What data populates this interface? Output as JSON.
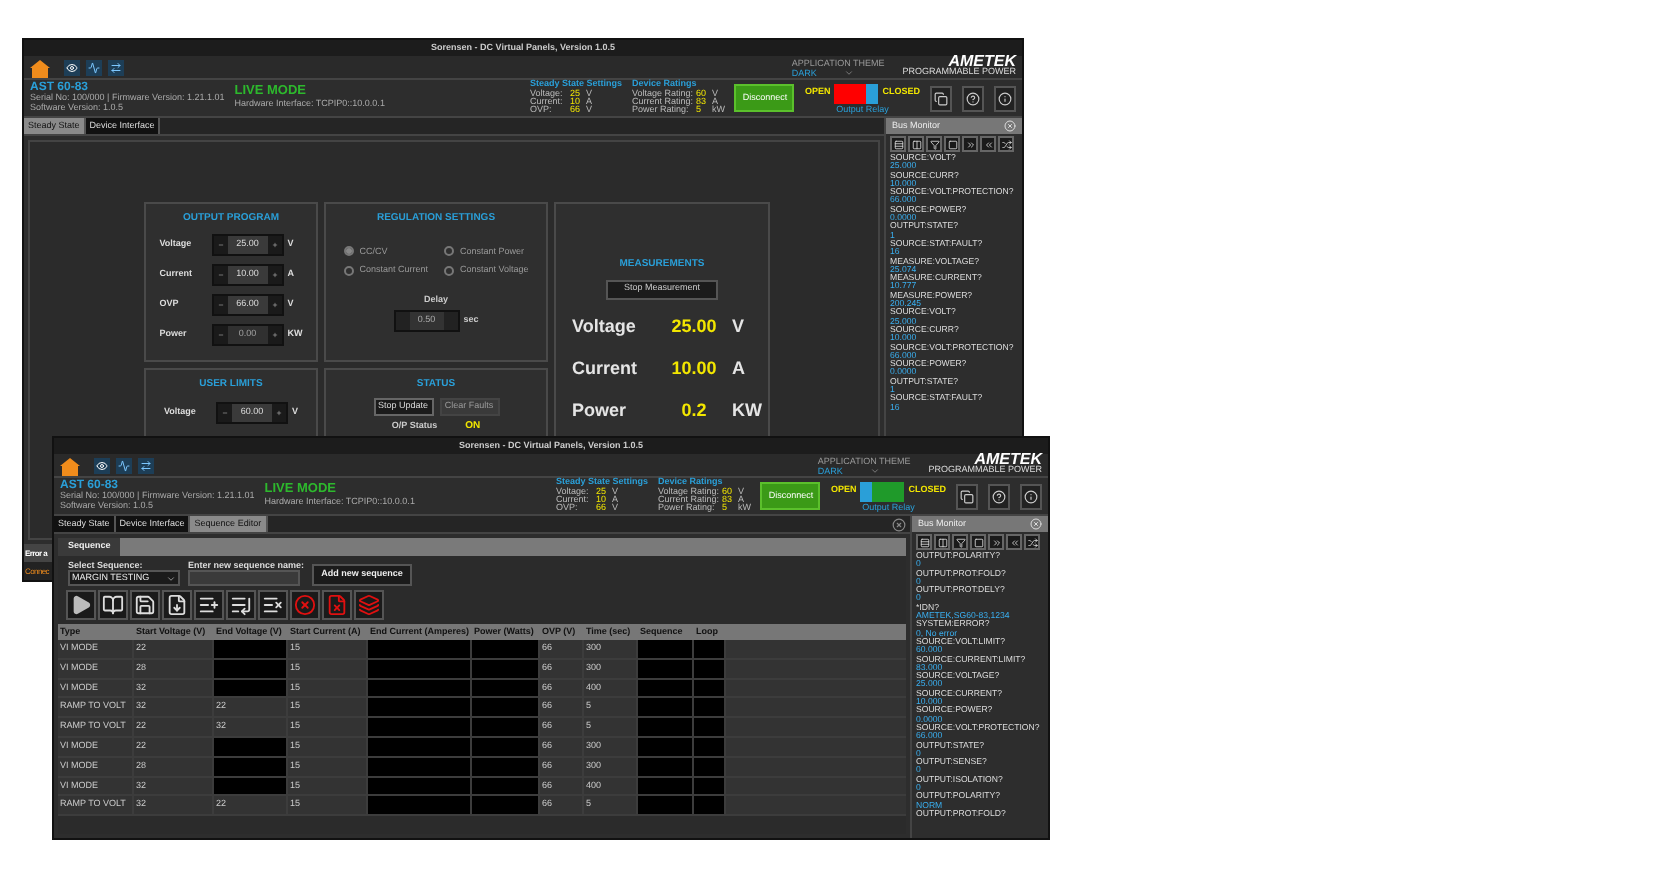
{
  "windows": [
    {
      "title": "Sorensen - DC Virtual Panels, Version 1.0.5",
      "theme_label": "APPLICATION THEME",
      "theme_value": "DARK",
      "logo": {
        "name": "AMETEK",
        "tagline": "PROGRAMMABLE POWER"
      },
      "device": {
        "model": "AST 60-83",
        "serial": "Serial No: 100/000 | Firmware Version: 1.21.1.01",
        "software": "Software Version: 1.0.5",
        "mode": "LIVE MODE",
        "interface": "Hardware Interface: TCPIP0::10.0.0.1"
      },
      "steady_state_settings": {
        "title": "Steady State Settings",
        "rows": [
          {
            "label": "Voltage:",
            "value": "25",
            "unit": "V"
          },
          {
            "label": "Current:",
            "value": "10",
            "unit": "A"
          },
          {
            "label": "OVP:",
            "value": "66",
            "unit": "V"
          }
        ]
      },
      "device_ratings": {
        "title": "Device Ratings",
        "rows": [
          {
            "label": "Voltage Rating:",
            "value": "60",
            "unit": "V"
          },
          {
            "label": "Current Rating:",
            "value": "83",
            "unit": "A"
          },
          {
            "label": "Power Rating:",
            "value": "5",
            "unit": "kW"
          }
        ]
      },
      "disconnect": "Disconnect",
      "relay": {
        "open": "OPEN",
        "closed": "CLOSED",
        "caption": "Output Relay",
        "is_closed": false
      },
      "tabs": [
        {
          "label": "Steady State",
          "selected": true
        },
        {
          "label": "Device Interface",
          "selected": false
        }
      ],
      "content": {
        "kind": "steady_state",
        "output_program": {
          "title": "OUTPUT PROGRAM",
          "rows": [
            {
              "label": "Voltage",
              "value": "25.00",
              "unit": "V",
              "disabled": false
            },
            {
              "label": "Current",
              "value": "10.00",
              "unit": "A",
              "disabled": false
            },
            {
              "label": "OVP",
              "value": "66.00",
              "unit": "V",
              "disabled": false
            },
            {
              "label": "Power",
              "value": "0.00",
              "unit": "KW",
              "disabled": true
            }
          ]
        },
        "regulation": {
          "title": "REGULATION SETTINGS",
          "options": [
            {
              "label": "CC/CV",
              "selected": true
            },
            {
              "label": "Constant Power",
              "selected": false
            },
            {
              "label": "Constant Current",
              "selected": false
            },
            {
              "label": "Constant Voltage",
              "selected": false
            }
          ],
          "delay": {
            "label": "Delay",
            "value": "0.50",
            "unit": "sec"
          }
        },
        "measurements": {
          "title": "MEASUREMENTS",
          "button": "Stop Measurement",
          "readings": [
            {
              "label": "Voltage",
              "value": "25.00",
              "unit": "V"
            },
            {
              "label": "Current",
              "value": "10.00",
              "unit": "A"
            },
            {
              "label": "Power",
              "value": "0.2",
              "unit": "KW"
            }
          ]
        },
        "user_limits": {
          "title": "USER LIMITS",
          "rows": [
            {
              "label": "Voltage",
              "value": "60.00",
              "unit": "V",
              "disabled": false
            }
          ]
        },
        "status": {
          "title": "STATUS",
          "buttons": [
            {
              "label": "Stop Update",
              "disabled": false
            },
            {
              "label": "Clear Faults",
              "disabled": true
            }
          ],
          "op_label": "O/P Status",
          "op_value": "ON"
        }
      },
      "bus_monitor": {
        "title": "Bus Monitor",
        "lines": [
          {
            "command": "SOURCE:VOLT?",
            "response": "25.000"
          },
          {
            "command": "SOURCE:CURR?",
            "response": "10.000"
          },
          {
            "command": "SOURCE:VOLT:PROTECTION?",
            "response": "66.000"
          },
          {
            "command": "SOURCE:POWER?",
            "response": "0.0000"
          },
          {
            "command": "OUTPUT:STATE?",
            "response": "1"
          },
          {
            "command": "SOURCE:STAT:FAULT?",
            "response": "16"
          },
          {
            "command": "MEASURE:VOLTAGE?",
            "response": "25.074"
          },
          {
            "command": "MEASURE:CURRENT?",
            "response": "10.777"
          },
          {
            "command": "MEASURE:POWER?",
            "response": "200.245"
          },
          {
            "command": "SOURCE:VOLT?",
            "response": "25.000"
          },
          {
            "command": "SOURCE:CURR?",
            "response": "10.000"
          },
          {
            "command": "SOURCE:VOLT:PROTECTION?",
            "response": "66.000"
          },
          {
            "command": "SOURCE:POWER?",
            "response": "0.0000"
          },
          {
            "command": "OUTPUT:STATE?",
            "response": "1"
          },
          {
            "command": "SOURCE:STAT:FAULT?",
            "response": "16"
          }
        ]
      },
      "status_bar": [
        {
          "text": "Error a",
          "kind": "error"
        },
        {
          "text": "Connec",
          "kind": "connection"
        }
      ]
    },
    {
      "title": "Sorensen - DC Virtual Panels, Version 1.0.5",
      "theme_label": "APPLICATION THEME",
      "theme_value": "DARK",
      "logo": {
        "name": "AMETEK",
        "tagline": "PROGRAMMABLE POWER"
      },
      "device": {
        "model": "AST 60-83",
        "serial": "Serial No: 100/000 | Firmware Version: 1.21.1.01",
        "software": "Software Version: 1.0.5",
        "mode": "LIVE MODE",
        "interface": "Hardware Interface: TCPIP0::10.0.0.1"
      },
      "steady_state_settings": {
        "title": "Steady State Settings",
        "rows": [
          {
            "label": "Voltage:",
            "value": "25",
            "unit": "V"
          },
          {
            "label": "Current:",
            "value": "10",
            "unit": "A"
          },
          {
            "label": "OVP:",
            "value": "66",
            "unit": "V"
          }
        ]
      },
      "device_ratings": {
        "title": "Device Ratings",
        "rows": [
          {
            "label": "Voltage Rating:",
            "value": "60",
            "unit": "V"
          },
          {
            "label": "Current Rating:",
            "value": "83",
            "unit": "A"
          },
          {
            "label": "Power Rating:",
            "value": "5",
            "unit": "kW"
          }
        ]
      },
      "disconnect": "Disconnect",
      "relay": {
        "open": "OPEN",
        "closed": "CLOSED",
        "caption": "Output Relay",
        "is_closed": true
      },
      "tabs": [
        {
          "label": "Steady State",
          "selected": false
        },
        {
          "label": "Device Interface",
          "selected": false
        },
        {
          "label": "Sequence Editor",
          "selected": true
        }
      ],
      "content": {
        "kind": "sequence_editor",
        "sequence_tab": "Sequence",
        "select_label": "Select Sequence:",
        "select_value": "MARGIN TESTING",
        "name_label": "Enter new sequence name:",
        "add_button": "Add new sequence",
        "table": {
          "columns": [
            "Type",
            "Start Voltage (V)",
            "End Voltage (V)",
            "Start Current (A)",
            "End Current (Amperes)",
            "Power (Watts)",
            "OVP (V)",
            "Time (sec)",
            "Sequence",
            "Loop"
          ],
          "rows": [
            [
              "VI MODE",
              "22",
              null,
              "15",
              null,
              null,
              "66",
              "300",
              null,
              null
            ],
            [
              "VI MODE",
              "28",
              null,
              "15",
              null,
              null,
              "66",
              "300",
              null,
              null
            ],
            [
              "VI MODE",
              "32",
              null,
              "15",
              null,
              null,
              "66",
              "400",
              null,
              null
            ],
            [
              "RAMP TO VOLT",
              "32",
              "22",
              "15",
              null,
              null,
              "66",
              "5",
              null,
              null
            ],
            [
              "RAMP TO VOLT",
              "22",
              "32",
              "15",
              null,
              null,
              "66",
              "5",
              null,
              null
            ],
            [
              "VI MODE",
              "22",
              null,
              "15",
              null,
              null,
              "66",
              "300",
              null,
              null
            ],
            [
              "VI MODE",
              "28",
              null,
              "15",
              null,
              null,
              "66",
              "300",
              null,
              null
            ],
            [
              "VI MODE",
              "32",
              null,
              "15",
              null,
              null,
              "66",
              "400",
              null,
              null
            ],
            [
              "RAMP TO VOLT",
              "32",
              "22",
              "15",
              null,
              null,
              "66",
              "5",
              null,
              null
            ]
          ]
        }
      },
      "bus_monitor": {
        "title": "Bus Monitor",
        "lines": [
          {
            "command": "OUTPUT:POLARITY?",
            "response": "0"
          },
          {
            "command": "OUTPUT:PROT:FOLD?",
            "response": "0"
          },
          {
            "command": "OUTPUT:PROT:DELY?",
            "response": "0"
          },
          {
            "command": "*IDN?",
            "response": "AMETEK,SG60-83,1234"
          },
          {
            "command": "SYSTEM:ERROR?",
            "response": "0, No error"
          },
          {
            "command": "SOURCE:VOLT:LIMIT?",
            "response": "60.000"
          },
          {
            "command": "SOURCE:CURRENT:LIMIT?",
            "response": "83.000"
          },
          {
            "command": "SOURCE:VOLTAGE?",
            "response": "25.000"
          },
          {
            "command": "SOURCE:CURRENT?",
            "response": "10.000"
          },
          {
            "command": "SOURCE:POWER?",
            "response": "0.0000"
          },
          {
            "command": "SOURCE:VOLT:PROTECTION?",
            "response": "66.000"
          },
          {
            "command": "OUTPUT:STATE?",
            "response": "0"
          },
          {
            "command": "OUTPUT:SENSE?",
            "response": "0"
          },
          {
            "command": "OUTPUT:ISOLATION?",
            "response": "0"
          },
          {
            "command": "OUTPUT:POLARITY?",
            "response": "NORM"
          },
          {
            "command": "OUTPUT:PROT:FOLD?"
          }
        ]
      }
    }
  ]
}
